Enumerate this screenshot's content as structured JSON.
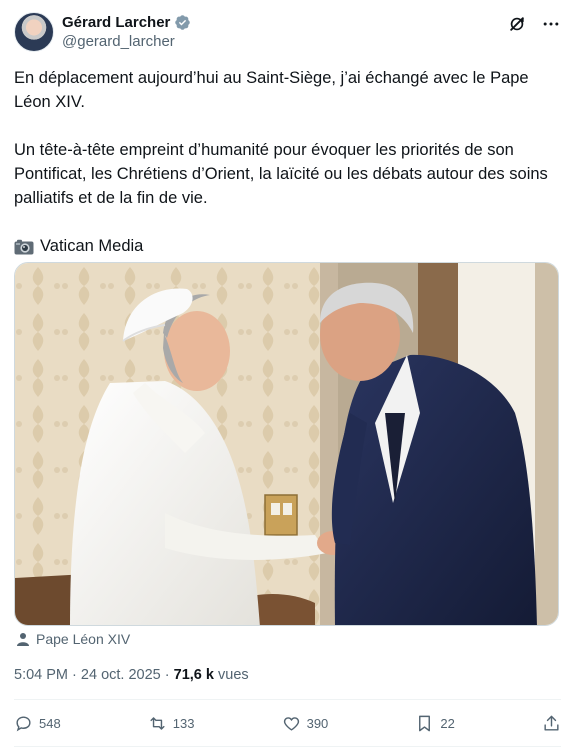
{
  "author": {
    "display_name": "Gérard Larcher",
    "handle": "@gerard_larcher",
    "verified": true
  },
  "tweet": {
    "paragraph_1": "En déplacement aujourd’hui au Saint-Siège, j’ai échangé avec le Pape Léon XIV.",
    "paragraph_2": "Un tête-à-tête empreint d’humanité pour évoquer les priorités de son Pontificat, les Chrétiens d’Orient, la laïcité ou les débats autour des soins palliatifs et de la fin de vie.",
    "credit": "Vatican Media",
    "credit_icon": "camera-icon"
  },
  "media": {
    "tagged_person": "Pape Léon XIV"
  },
  "meta": {
    "time": "5:04 PM",
    "separator": "·",
    "date": "24 oct. 2025",
    "views_count": "71,6 k",
    "views_label": "vues"
  },
  "actions": {
    "replies": "548",
    "reposts": "133",
    "likes": "390",
    "bookmarks": "22"
  },
  "colors": {
    "text": "#0f1419",
    "secondary": "#536471",
    "verified": "#829aab",
    "border": "#eff3f4"
  }
}
